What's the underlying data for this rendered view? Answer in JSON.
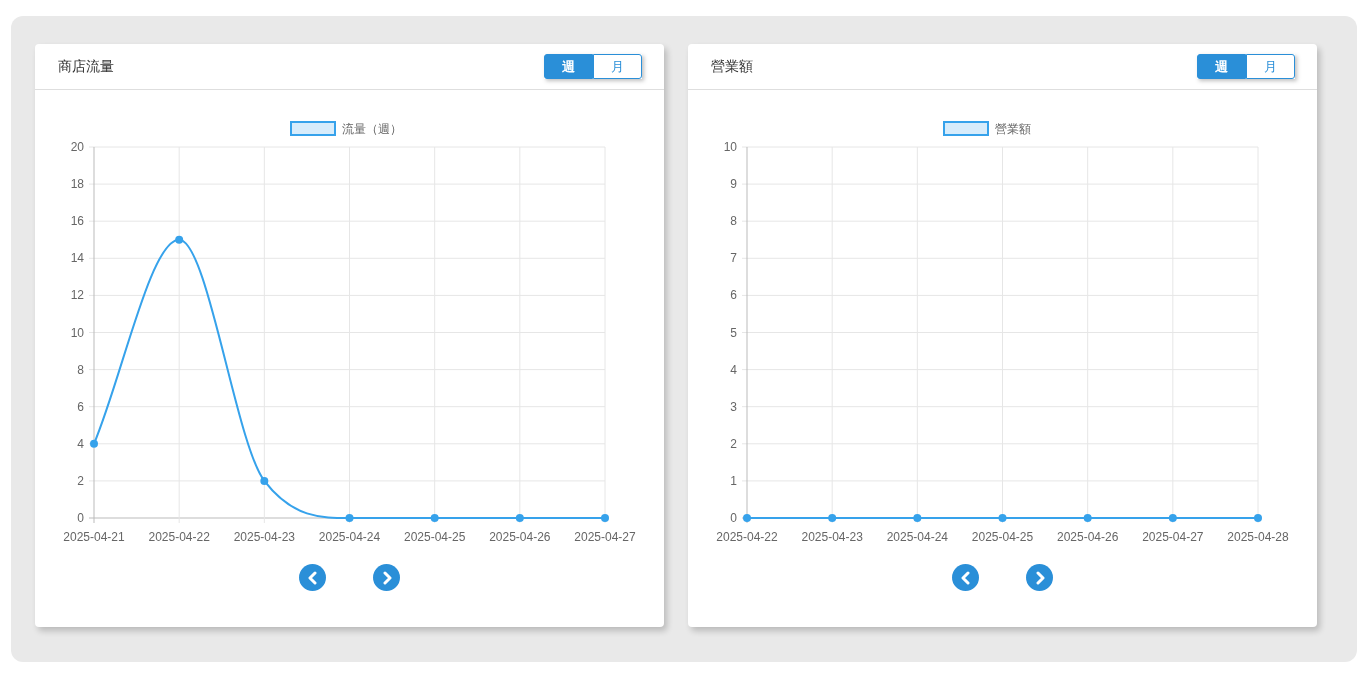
{
  "panels": [
    {
      "title": "商店流量",
      "toggle": [
        {
          "label": "週",
          "selected": true
        },
        {
          "label": "月",
          "selected": false
        }
      ],
      "chart_data": {
        "type": "line",
        "categories": [
          "2025-04-21",
          "2025-04-22",
          "2025-04-23",
          "2025-04-24",
          "2025-04-25",
          "2025-04-26",
          "2025-04-27"
        ],
        "grid": true,
        "series": [
          {
            "name": "流量（週）",
            "color": "#36a2eb",
            "marker": true,
            "values": [
              4,
              15,
              2,
              0,
              0,
              0,
              0
            ]
          }
        ],
        "ylim": [
          0,
          20
        ],
        "yticks": [
          0,
          2,
          4,
          6,
          8,
          10,
          12,
          14,
          16,
          18,
          20
        ]
      }
    },
    {
      "title": "營業額",
      "toggle": [
        {
          "label": "週",
          "selected": true
        },
        {
          "label": "月",
          "selected": false
        }
      ],
      "chart_data": {
        "type": "line",
        "categories": [
          "2025-04-22",
          "2025-04-23",
          "2025-04-24",
          "2025-04-25",
          "2025-04-26",
          "2025-04-27",
          "2025-04-28"
        ],
        "grid": true,
        "series": [
          {
            "name": "營業額",
            "color": "#36a2eb",
            "marker": true,
            "values": [
              0,
              0,
              0,
              0,
              0,
              0,
              0
            ]
          }
        ],
        "ylim": [
          0,
          10
        ],
        "yticks": [
          0,
          1,
          2,
          3,
          4,
          5,
          6,
          7,
          8,
          9,
          10
        ]
      }
    }
  ]
}
